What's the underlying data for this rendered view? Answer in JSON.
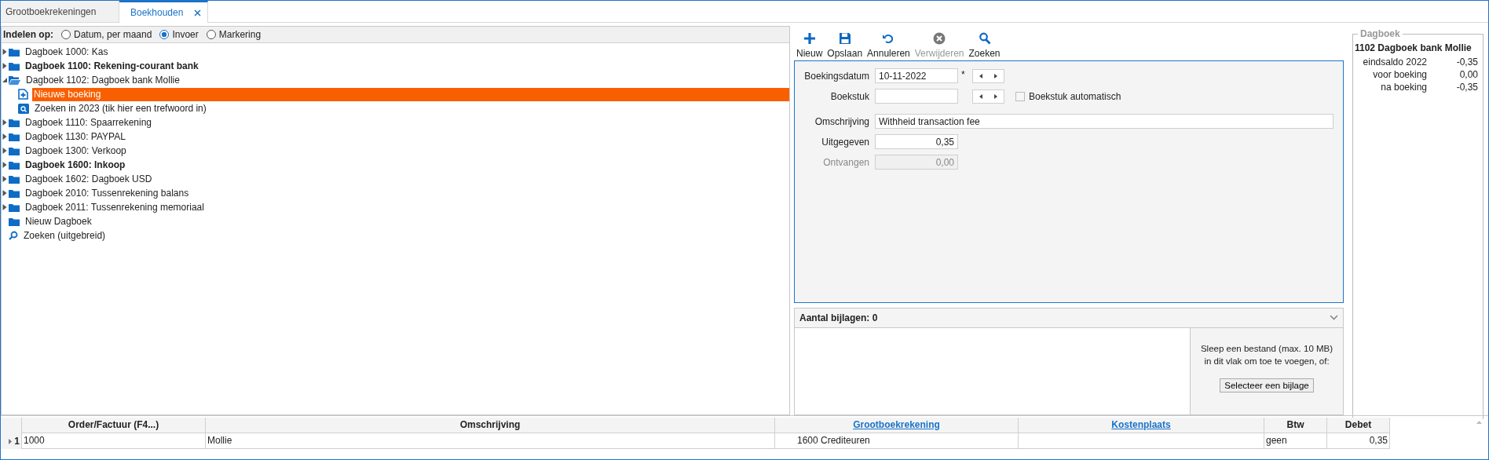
{
  "tabs": [
    {
      "label": "Grootboekrekeningen",
      "selected": false,
      "closable": false
    },
    {
      "label": "Boekhouden",
      "selected": true,
      "closable": true
    }
  ],
  "group_by": {
    "label": "Indelen op:",
    "options": [
      {
        "label": "Datum, per maand",
        "selected": false
      },
      {
        "label": "Invoer",
        "selected": true
      },
      {
        "label": "Markering",
        "selected": false
      }
    ]
  },
  "tree": [
    {
      "label": "Dagboek 1000: Kas",
      "kind": "folder",
      "bold": false,
      "expanded": false,
      "selected": false
    },
    {
      "label": "Dagboek 1100: Rekening-courant bank",
      "kind": "folder",
      "bold": true,
      "expanded": false,
      "selected": false
    },
    {
      "label": "Dagboek 1102: Dagboek bank Mollie",
      "kind": "folder-open",
      "bold": false,
      "expanded": true,
      "selected": false,
      "children": [
        {
          "label": "Nieuwe boeking",
          "kind": "new-doc",
          "bold": false,
          "selected": true
        },
        {
          "label": "Zoeken in 2023 (tik hier een trefwoord in)",
          "kind": "search-doc",
          "bold": false,
          "selected": false
        }
      ]
    },
    {
      "label": "Dagboek 1110: Spaarrekening",
      "kind": "folder",
      "bold": false,
      "expanded": false,
      "selected": false
    },
    {
      "label": "Dagboek 1130: PAYPAL",
      "kind": "folder",
      "bold": false,
      "expanded": false,
      "selected": false
    },
    {
      "label": "Dagboek 1300: Verkoop",
      "kind": "folder",
      "bold": false,
      "expanded": false,
      "selected": false
    },
    {
      "label": "Dagboek 1600: Inkoop",
      "kind": "folder",
      "bold": true,
      "expanded": false,
      "selected": false
    },
    {
      "label": "Dagboek 1602: Dagboek USD",
      "kind": "folder",
      "bold": false,
      "expanded": false,
      "selected": false
    },
    {
      "label": "Dagboek 2010: Tussenrekening balans",
      "kind": "folder",
      "bold": false,
      "expanded": false,
      "selected": false
    },
    {
      "label": "Dagboek 2011: Tussenrekening memoriaal",
      "kind": "folder",
      "bold": false,
      "expanded": false,
      "selected": false
    },
    {
      "label": "Nieuw Dagboek",
      "kind": "folder",
      "bold": false,
      "selected": false
    },
    {
      "label": "Zoeken (uitgebreid)",
      "kind": "search",
      "bold": false,
      "selected": false
    }
  ],
  "toolbar": [
    {
      "label": "Nieuw",
      "kind": "plus",
      "disabled": false
    },
    {
      "label": "Opslaan",
      "kind": "save",
      "disabled": false
    },
    {
      "label": "Annuleren",
      "kind": "undo",
      "disabled": false
    },
    {
      "label": "Verwijderen",
      "kind": "delete",
      "disabled": true
    },
    {
      "label": "Zoeken",
      "kind": "search",
      "disabled": false
    }
  ],
  "form": [
    {
      "kind": "date",
      "label": "Boekingsdatum",
      "value": "10-11-2022",
      "required": "*",
      "stepper": true,
      "disabled": false
    },
    {
      "kind": "date",
      "label": "Boekstuk",
      "stepper": true,
      "disabled": false,
      "checkbox": {
        "label": "Boekstuk automatisch",
        "checked": false
      }
    },
    {
      "kind": "text",
      "label": "Omschrijving",
      "value": "Withheid transaction fee",
      "stepper": false,
      "disabled": false
    },
    {
      "kind": "amount",
      "label": "Uitgegeven",
      "value": "0,35",
      "stepper": false,
      "disabled": false
    },
    {
      "kind": "amount",
      "label": "Ontvangen",
      "value": "0,00",
      "stepper": false,
      "disabled": true
    }
  ],
  "attachments": {
    "title": "Aantal bijlagen: 0",
    "hint": "Sleep een bestand (max. 10 MB)\nin dit vlak om toe te voegen, of:",
    "button": "Selecteer een bijlage"
  },
  "dagboek": {
    "title": "Dagboek",
    "heading": "1102 Dagboek bank Mollie",
    "rows": [
      {
        "label": "eindsaldo 2022",
        "value": "-0,35"
      },
      {
        "label": "voor boeking",
        "value": "0,00"
      },
      {
        "label": "na boeking",
        "value": "-0,35"
      }
    ]
  },
  "grid": {
    "columns": [
      {
        "label": "Order/Factuur (F4...)",
        "link": false,
        "kind": "text"
      },
      {
        "label": "Omschrijving",
        "link": false,
        "kind": "text"
      },
      {
        "label": "Grootboekrekening",
        "link": true,
        "kind": "account"
      },
      {
        "label": "Kostenplaats",
        "link": true,
        "kind": "text"
      },
      {
        "label": "Btw",
        "link": false,
        "kind": "text"
      },
      {
        "label": "Debet",
        "link": false,
        "kind": "amount"
      }
    ],
    "rows": [
      {
        "number": "1",
        "cells": [
          "1000",
          "Mollie",
          "1600 Crediteuren",
          "",
          "geen",
          "0,35"
        ]
      }
    ]
  }
}
